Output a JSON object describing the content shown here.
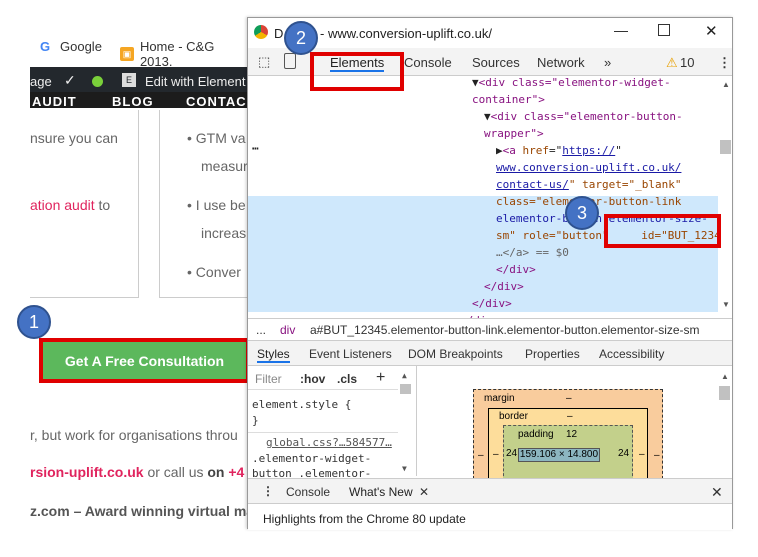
{
  "browser": {
    "bookmarks": [
      {
        "label": "Google",
        "icon": "google-icon"
      },
      {
        "label": "Home - C&G 2013.",
        "icon": "cg-icon"
      }
    ]
  },
  "wp_admin": {
    "left_label": "age",
    "edit_label": "Edit with Element"
  },
  "site_nav": {
    "items": [
      "AUDIT",
      "BLOG",
      "CONTAC"
    ]
  },
  "page": {
    "text_1": "nsure you can",
    "text_2_link": "ation audit",
    "text_2_rest": "to",
    "bullets": [
      "GTM va",
      "measur",
      "I use be",
      "increas",
      "Conver"
    ],
    "cta_label": "Get A Free Consultation",
    "text_3": "r,  but work for organisations throu",
    "text_4_link": "rsion-uplift.co.uk",
    "text_4_rest": "or call us",
    "text_4_on": "on",
    "text_4_phone": "+4",
    "text_5": "z.com – Award winning virtual ma"
  },
  "devtools": {
    "title_prefix": "D",
    "title_url": "- www.conversion-uplift.co.uk/",
    "tabs": [
      "Elements",
      "Console",
      "Sources",
      "Network",
      "»"
    ],
    "warning_count": "10",
    "code_lines": {
      "l1": "<div class=\"elementor-widget-",
      "l2": "container\">",
      "l3": "<div class=\"elementor-button-",
      "l4": "wrapper\">",
      "l5_href": "https://",
      "l6": "www.conversion-uplift.co.uk/",
      "l7a": "contact-us/",
      "l7b": "\" target=\"_blank\"",
      "l8": "class=\"elementor-button-link",
      "l9": "elementor-button elementor-size-",
      "l10a": "sm\" role=\"button\"",
      "l10b": "id=\"BUT_12345\"",
      "l11": "…</a> == $0",
      "l12": "</div>",
      "l13": "</div>",
      "l14": "</div>",
      "l15": "</div>"
    },
    "breadcrumb": {
      "dots": "...",
      "div": "div",
      "selector": "a#BUT_12345.elementor-button-link.elementor-button.elementor-size-sm"
    },
    "subtabs": [
      "Styles",
      "Event Listeners",
      "DOM Breakpoints",
      "Properties",
      "Accessibility"
    ],
    "filter": {
      "placeholder": "Filter",
      "hov": ":hov",
      "cls": ".cls",
      "plus": "+"
    },
    "styles": {
      "element_style": "element.style {",
      "close_brace": "}",
      "source": "global.css?…584577…",
      "selector_1": ".elementor-widget-",
      "selector_2": "button .elementor-"
    },
    "box_model": {
      "margin_label": "margin",
      "margin_val": "–",
      "border_label": "border",
      "border_val": "–",
      "padding_label": "padding",
      "padding_val": "12",
      "content": "159.106 × 14.800",
      "left": "24",
      "right": "24",
      "side_dash": "–"
    },
    "drawer_tabs": [
      "Console",
      "What's New"
    ],
    "close_x": "✕",
    "highlights": "Highlights from the Chrome 80 update"
  },
  "annotations": {
    "badge_1": "1",
    "badge_2": "2",
    "badge_3": "3"
  },
  "colors": {
    "cta_green": "#5cb85c",
    "red_highlight": "#e00000",
    "badge_blue": "#4472c4",
    "link_pink": "#e0245e"
  }
}
